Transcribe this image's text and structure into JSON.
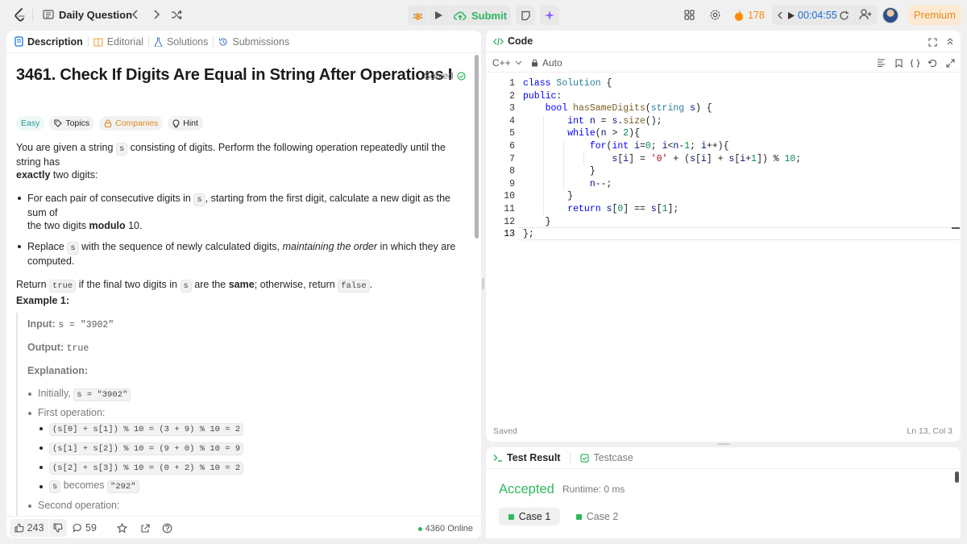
{
  "topbar": {
    "title": "Daily Question",
    "submit": "Submit",
    "streak": "178",
    "timer": "00:04:55",
    "premium": "Premium"
  },
  "left_tabs": {
    "description": "Description",
    "editorial": "Editorial",
    "solutions": "Solutions",
    "submissions": "Submissions"
  },
  "problem": {
    "title": "3461. Check If Digits Are Equal in String After Operations I",
    "solved": "Solved",
    "tags": {
      "difficulty": "Easy",
      "topics": "Topics",
      "companies": "Companies",
      "hint": "Hint"
    },
    "p1a": "You are given a string",
    "p1s": "s",
    "p1b": "consisting of digits. Perform the following operation repeatedly until the string has",
    "p1c": "exactly",
    "p1d": "two digits:",
    "b1a": "For each pair of consecutive digits in",
    "b1s": "s",
    "b1b": ", starting from the first digit, calculate a new digit as the sum of",
    "b1c": "the two digits",
    "b1d": "modulo",
    "b1e": "10.",
    "b2a": "Replace",
    "b2s": "s",
    "b2b": "with the sequence of newly calculated digits,",
    "b2c": "maintaining the order",
    "b2d": "in which they are",
    "b2e": "computed.",
    "r1": "Return",
    "r_true": "true",
    "r2": "if the final two digits in",
    "r_s": "s",
    "r3": "are the",
    "r_same": "same",
    "r4": "; otherwise, return",
    "r_false": "false",
    "r5": "."
  },
  "example": {
    "heading": "Example 1:",
    "input_label": "Input:",
    "input_val": "s = \"3902\"",
    "output_label": "Output:",
    "output_val": "true",
    "expl_label": "Explanation:",
    "initially": "Initially,",
    "initially_code": "s = \"3902\"",
    "first_op": "First operation:",
    "ops": [
      "(s[0] + s[1]) % 10 = (3 + 9) % 10 = 2",
      "(s[1] + s[2]) % 10 = (9 + 0) % 10 = 9",
      "(s[2] + s[3]) % 10 = (0 + 2) % 10 = 2"
    ],
    "becomes_s": "s",
    "becomes": "becomes",
    "becomes_val": "\"292\"",
    "second_op": "Second operation:"
  },
  "footer": {
    "likes": "243",
    "comments": "59",
    "online": "4360 Online"
  },
  "code_panel": {
    "title": "Code",
    "lang": "C++",
    "auto": "Auto",
    "saved": "Saved",
    "cursor": "Ln 13, Col 3"
  },
  "result_panel": {
    "tab1": "Test Result",
    "tab2": "Testcase",
    "status": "Accepted",
    "runtime": "Runtime: 0 ms",
    "case1": "Case 1",
    "case2": "Case 2"
  },
  "colors": {
    "accent_green": "#2db55d",
    "accepted": "#2cbb5d",
    "orange": "#ff8a00",
    "premium_bg": "#fde9d3",
    "premium_text": "#e08a1e",
    "easy": "#1f9c94"
  }
}
